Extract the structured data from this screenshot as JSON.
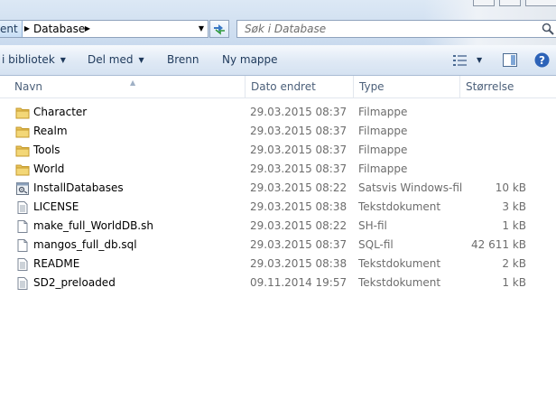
{
  "address": {
    "prev_crumb": "ent",
    "current_crumb": "Database",
    "search_placeholder": "Søk i Database"
  },
  "toolbar": {
    "library_label": "i bibliotek",
    "share_label": "Del med",
    "burn_label": "Brenn",
    "new_folder_label": "Ny mappe"
  },
  "columns": {
    "name": "Navn",
    "date": "Dato endret",
    "type": "Type",
    "size": "Størrelse"
  },
  "files": [
    {
      "name": "Character",
      "date": "29.03.2015 08:37",
      "type": "Filmappe",
      "size": "",
      "icon": "folder-icon"
    },
    {
      "name": "Realm",
      "date": "29.03.2015 08:37",
      "type": "Filmappe",
      "size": "",
      "icon": "folder-icon"
    },
    {
      "name": "Tools",
      "date": "29.03.2015 08:37",
      "type": "Filmappe",
      "size": "",
      "icon": "folder-icon"
    },
    {
      "name": "World",
      "date": "29.03.2015 08:37",
      "type": "Filmappe",
      "size": "",
      "icon": "folder-icon"
    },
    {
      "name": "InstallDatabases",
      "date": "29.03.2015 08:22",
      "type": "Satsvis Windows-fil",
      "size": "10 kB",
      "icon": "batch-file-icon"
    },
    {
      "name": "LICENSE",
      "date": "29.03.2015 08:38",
      "type": "Tekstdokument",
      "size": "3 kB",
      "icon": "text-file-icon"
    },
    {
      "name": "make_full_WorldDB.sh",
      "date": "29.03.2015 08:22",
      "type": "SH-fil",
      "size": "1 kB",
      "icon": "blank-file-icon"
    },
    {
      "name": "mangos_full_db.sql",
      "date": "29.03.2015 08:37",
      "type": "SQL-fil",
      "size": "42 611 kB",
      "icon": "blank-file-icon"
    },
    {
      "name": "README",
      "date": "29.03.2015 08:38",
      "type": "Tekstdokument",
      "size": "2 kB",
      "icon": "text-file-icon"
    },
    {
      "name": "SD2_preloaded",
      "date": "09.11.2014 19:57",
      "type": "Tekstdokument",
      "size": "1 kB",
      "icon": "text-file-icon"
    }
  ],
  "colors": {
    "folder": "#e8c35a",
    "toolbar_text": "#1e395b",
    "secondary_text": "#6d6d6d"
  }
}
